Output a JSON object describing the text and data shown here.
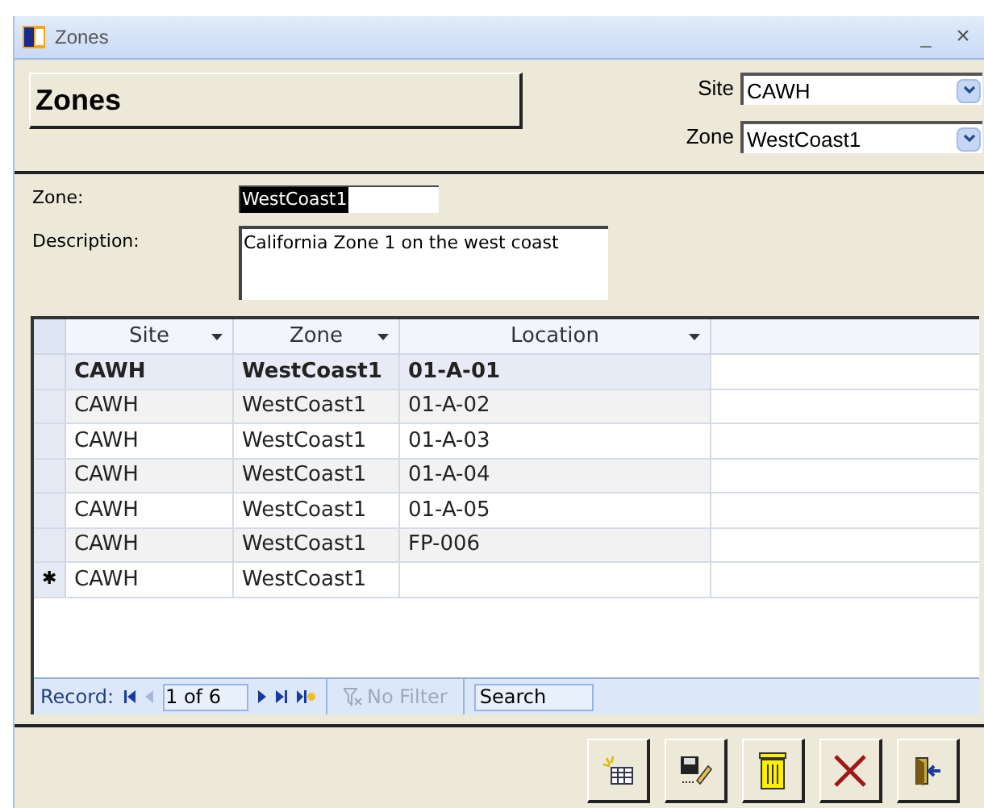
{
  "window": {
    "title": "Zones",
    "close": "×",
    "minimize": "_"
  },
  "header": {
    "title": "Zones",
    "site": {
      "label": "Site",
      "value": "CAWH"
    },
    "zone": {
      "label": "Zone",
      "value": "WestCoast1"
    }
  },
  "form": {
    "zone": {
      "label": "Zone:",
      "value": "WestCoast1"
    },
    "description": {
      "label": "Description:",
      "value": "California Zone 1 on the west coast"
    }
  },
  "table": {
    "columns": [
      "Site",
      "Zone",
      "Location"
    ],
    "rows": [
      {
        "cells": [
          "CAWH",
          "WestCoast1",
          "01-A-01"
        ],
        "selected": true
      },
      {
        "cells": [
          "CAWH",
          "WestCoast1",
          "01-A-02"
        ],
        "selected": false
      },
      {
        "cells": [
          "CAWH",
          "WestCoast1",
          "01-A-03"
        ],
        "selected": false
      },
      {
        "cells": [
          "CAWH",
          "WestCoast1",
          "01-A-04"
        ],
        "selected": false
      },
      {
        "cells": [
          "CAWH",
          "WestCoast1",
          "01-A-05"
        ],
        "selected": false
      },
      {
        "cells": [
          "CAWH",
          "WestCoast1",
          "FP-006"
        ],
        "selected": false
      }
    ],
    "new_row": {
      "marker": "✱",
      "cells": [
        "CAWH",
        "WestCoast1",
        ""
      ]
    }
  },
  "navigator": {
    "label": "Record:",
    "position": "1 of 6",
    "filter": "No Filter",
    "search": "Search"
  },
  "toolbar": [
    {
      "kind": "new"
    },
    {
      "kind": "save"
    },
    {
      "kind": "delete"
    },
    {
      "kind": "cancel"
    },
    {
      "kind": "exit"
    }
  ]
}
